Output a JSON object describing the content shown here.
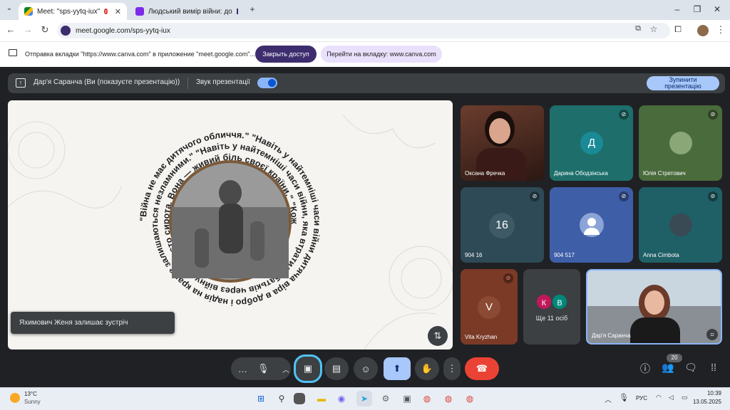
{
  "tabs": [
    {
      "title": "Meet: \"sps-yytq-iux\"",
      "active": true
    },
    {
      "title": "Людський вимір війни: до",
      "active": false
    }
  ],
  "address": {
    "url": "meet.google.com/sps-yytq-iux"
  },
  "infobar": {
    "message": "Отправка вкладки \"https://www.canva.com\" в приложение \"meet.google.com\"...",
    "share_label": "Закрыть доступ",
    "goto_label": "Перейти на вкладку: www.canva.com"
  },
  "presentation": {
    "presenter": "Дар'я Саранча (Ви (показуєте презентацію))",
    "sound_label": "Звук презентації",
    "stop_label_1": "Зупинити",
    "stop_label_2": "презентацію"
  },
  "slide": {
    "spiral_text": "\"Війна не має дитячого обличчя.\" \"Навіть у найтемніші часи війни дитяча віра в добро і надія на краще залишаються незламними.\" \"Навіть у найтемніші часи війни, яка втратила батьків через війну, не просто сирота. Вона — живий біль своєї країни.\" \"Кожна дитина, глибоко вкарбовуються в дитячі серця, часом вони ніколи не зникають.\" \"Навіть у найтемніші часи війни дитяча віра в добро і надія на краще залишаються незламними\""
  },
  "toast": "Яхимович Женя залишає зустріч",
  "participants": [
    {
      "name": "Оксана Фречка",
      "initial": ""
    },
    {
      "name": "Дарина Ободзінська",
      "initial": "Д"
    },
    {
      "name": "Юлія Стретович",
      "initial": ""
    },
    {
      "name": "904 16",
      "initial": "16"
    },
    {
      "name": "904 517",
      "initial": ""
    },
    {
      "name": "Anna Cimbota",
      "initial": ""
    },
    {
      "name": "Vita Kryzhan",
      "initial": "V"
    },
    {
      "name": "Ще 11 осіб",
      "initial": ""
    },
    {
      "name": "Дар'я Саранча",
      "initial": ""
    }
  ],
  "more_avatars": [
    "К",
    "В"
  ],
  "people_count": "20",
  "weather": {
    "temp": "13°C",
    "desc": "Sunny"
  },
  "tray": {
    "lang": "РУС",
    "time": "10:39",
    "date": "13.05.2025"
  },
  "colors": {
    "accent_blue": "#8ab4f8",
    "end_call_red": "#ea4335",
    "purple_btn": "#3d2d6e"
  }
}
